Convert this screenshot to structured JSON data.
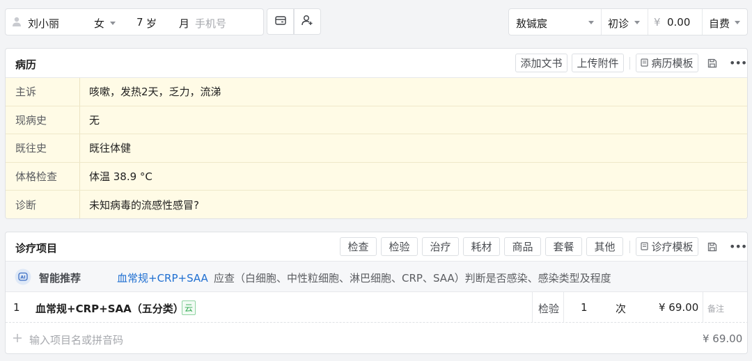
{
  "patient": {
    "name": "刘小丽",
    "gender": "女",
    "age": "7",
    "age_unit": "岁",
    "month_unit": "月",
    "phone_placeholder": "手机号"
  },
  "visit": {
    "doctor": "敖铖宸",
    "visit_type": "初诊",
    "currency": "¥",
    "fee": "0.00",
    "payment": "自费"
  },
  "record": {
    "title": "病历",
    "actions": {
      "add_doc": "添加文书",
      "upload": "上传附件",
      "template": "病历模板"
    },
    "fields": [
      {
        "label": "主诉",
        "value": "咳嗽，发热2天，乏力，流涕"
      },
      {
        "label": "现病史",
        "value": "无"
      },
      {
        "label": "既往史",
        "value": "既往体健"
      },
      {
        "label": "体格检查",
        "value": "体温 38.9 °C"
      },
      {
        "label": "诊断",
        "value": "未知病毒的流感性感冒?"
      }
    ]
  },
  "items": {
    "title": "诊疗项目",
    "categories": [
      "检查",
      "检验",
      "治疗",
      "耗材",
      "商品",
      "套餐",
      "其他"
    ],
    "template": "诊疗模板",
    "recommend": {
      "label": "智能推荐",
      "link": "血常规+CRP+SAA",
      "desc": "应查（白细胞、中性粒细胞、淋巴细胞、CRP、SAA）判断是否感染、感染类型及程度"
    },
    "rows": [
      {
        "index": "1",
        "name": "血常规+CRP+SAA（五分类）",
        "tag": "云",
        "type": "检验",
        "qty": "1",
        "unit": "次",
        "price": "¥ 69.00",
        "note_placeholder": "备注"
      }
    ],
    "input_placeholder": "输入项目名或拼音码",
    "total": "¥ 69.00"
  },
  "colors": {
    "link": "#1f6fd1",
    "cloud_tag": "#2fa84f",
    "highlight_bg": "#fffbe6"
  }
}
